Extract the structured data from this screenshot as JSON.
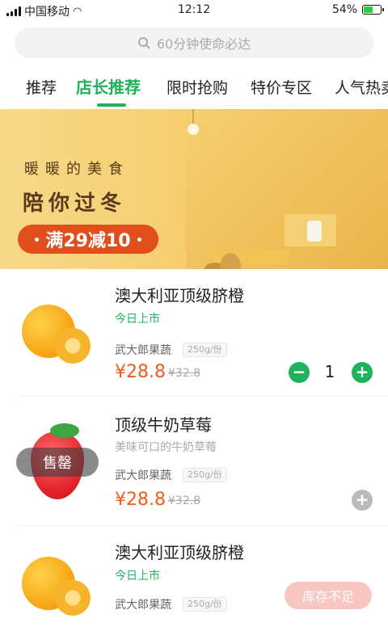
{
  "status_bar": {
    "carrier": "中国移动",
    "time": "12:12",
    "battery": "54%",
    "battery_level": 0.54
  },
  "search": {
    "placeholder": "60分钟使命必达"
  },
  "tabs": [
    {
      "label": "推荐"
    },
    {
      "label": "店长推荐",
      "active": true
    },
    {
      "label": "限时抢购"
    },
    {
      "label": "特价专区"
    },
    {
      "label": "人气热卖"
    }
  ],
  "banner": {
    "line1": "暖暖的美食",
    "line2": "陪你过冬",
    "promo": "满29减10"
  },
  "products": [
    {
      "name": "澳大利亚顶级脐橙",
      "tag": "今日上市",
      "shop": "武大郎果蔬",
      "unit": "250g/份",
      "price": "¥28.8",
      "original_price": "¥32.8",
      "quantity": "1"
    },
    {
      "name": "顶级牛奶草莓",
      "tag": "美味可口的牛奶草莓",
      "shop": "武大郎果蔬",
      "unit": "250g/份",
      "price": "¥28.8",
      "original_price": "¥32.8",
      "status": "售罄"
    },
    {
      "name": "澳大利亚顶级脐橙",
      "tag": "今日上市",
      "shop": "武大郎果蔬",
      "unit": "250g/份",
      "status": "库存不足"
    }
  ],
  "icons": {
    "minus": "−",
    "plus": "+"
  },
  "colors": {
    "accent": "#1fb25a",
    "price": "#f25b1d",
    "promo": "#e04e1c"
  }
}
